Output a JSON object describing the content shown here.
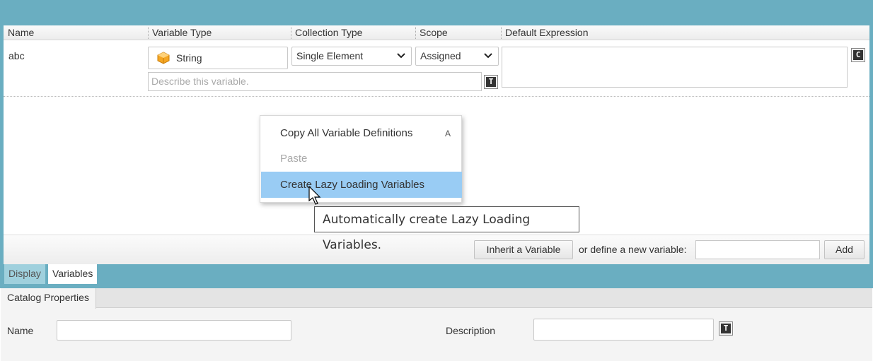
{
  "grid": {
    "columns": [
      "Name",
      "Variable Type",
      "Collection Type",
      "Scope",
      "Default Expression"
    ],
    "row": {
      "name": "abc",
      "type": "String",
      "collection": "Single Element",
      "scope": "Assigned",
      "description_placeholder": "Describe this variable."
    }
  },
  "context_menu": {
    "items": [
      {
        "label": "Copy All Variable Definitions",
        "accel": "A"
      },
      {
        "label": "Paste"
      },
      {
        "label": "Create Lazy Loading Variables"
      }
    ]
  },
  "tooltip": "Automatically create Lazy Loading Variables.",
  "add_bar": {
    "inherit_label": "Inherit a Variable",
    "or_label": "or define a new variable:",
    "add_label": "Add"
  },
  "tabs": [
    "Display",
    "Variables"
  ],
  "properties": {
    "tab": "Catalog Properties",
    "name_label": "Name",
    "description_label": "Description"
  },
  "colors": {
    "frame": "#6aaec1",
    "menu_highlight": "#99ccf4",
    "type_icon": "#f5a623"
  },
  "icons": [
    "string-type-icon",
    "chevron-down-icon",
    "text-editor-icon",
    "code-editor-icon",
    "mouse-cursor-icon"
  ]
}
